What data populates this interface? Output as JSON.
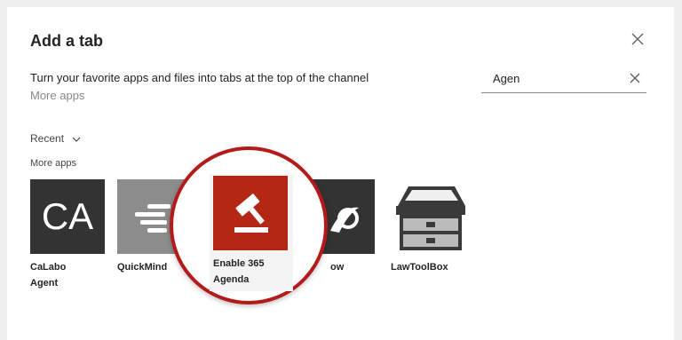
{
  "dialog": {
    "title": "Add a tab",
    "subtitle": "Turn your favorite apps and files into tabs at the top of the channel",
    "more_apps_link": "More apps"
  },
  "search": {
    "value": "Agen"
  },
  "recent": {
    "label": "Recent"
  },
  "section": {
    "label": "More apps"
  },
  "apps": [
    {
      "name": "CaLabo\nAgent",
      "icon_text": "CA",
      "icon": "ca-text-icon",
      "color": "#333333"
    },
    {
      "name": "QuickMind",
      "icon": "quickmind-lines-icon",
      "color": "#8c8c8c"
    },
    {
      "name": "Enable 365\nAgenda",
      "icon": "gavel-icon",
      "color": "#b52715"
    },
    {
      "name": "ow",
      "icon": "swirl-icon",
      "color": "#333333"
    },
    {
      "name": "LawToolBox",
      "icon": "toolbox-icon",
      "color": "#333333"
    }
  ],
  "colors": {
    "highlight": "#b51a1a",
    "text": "#252423",
    "muted": "#8a8886"
  }
}
